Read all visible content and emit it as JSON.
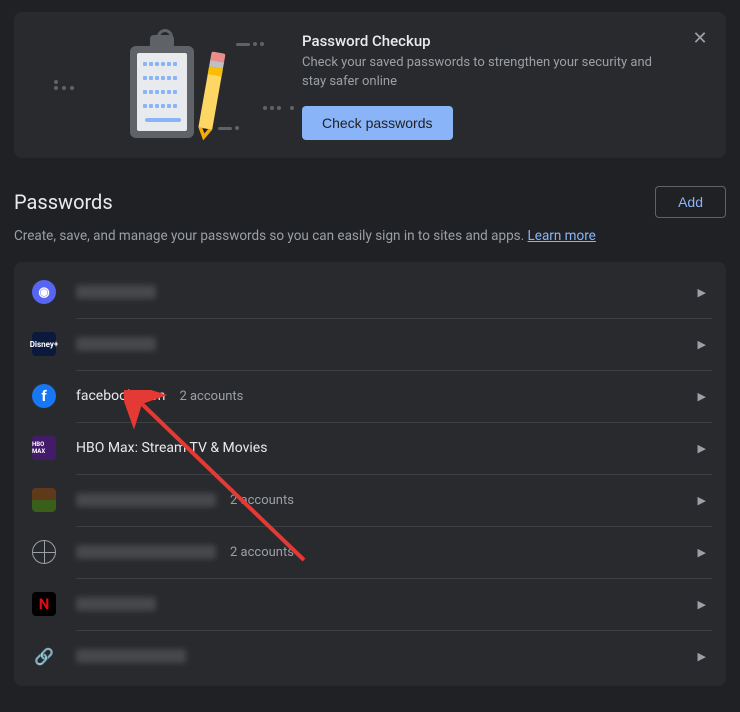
{
  "banner": {
    "title": "Password Checkup",
    "description": "Check your saved passwords to strengthen your security and stay safer online",
    "check_button": "Check passwords"
  },
  "section": {
    "title": "Passwords",
    "add_button": "Add",
    "description": "Create, save, and manage your passwords so you can easily sign in to sites and apps. ",
    "learn_more": "Learn more"
  },
  "rows": [
    {
      "site": "",
      "blurred": true,
      "accounts": "",
      "icon": "discord"
    },
    {
      "site": "",
      "blurred": true,
      "accounts": "",
      "icon": "disney"
    },
    {
      "site": "facebook.com",
      "blurred": false,
      "accounts": "2 accounts",
      "icon": "fb"
    },
    {
      "site": "HBO Max: Stream TV & Movies",
      "blurred": false,
      "accounts": "",
      "icon": "hbo"
    },
    {
      "site": "",
      "blurred": true,
      "accounts": "2 accounts",
      "icon": "strip"
    },
    {
      "site": "",
      "blurred": true,
      "accounts": "2 accounts",
      "icon": "globe"
    },
    {
      "site": "",
      "blurred": true,
      "accounts": "",
      "icon": "netflix"
    },
    {
      "site": "",
      "blurred": true,
      "accounts": "",
      "icon": "link"
    }
  ],
  "icons": {
    "discord_glyph": "◉",
    "disney_glyph": "Disney+",
    "fb_glyph": "f",
    "hbo_glyph": "HBO MAX",
    "netflix_glyph": "N",
    "link_glyph": "🔗"
  }
}
